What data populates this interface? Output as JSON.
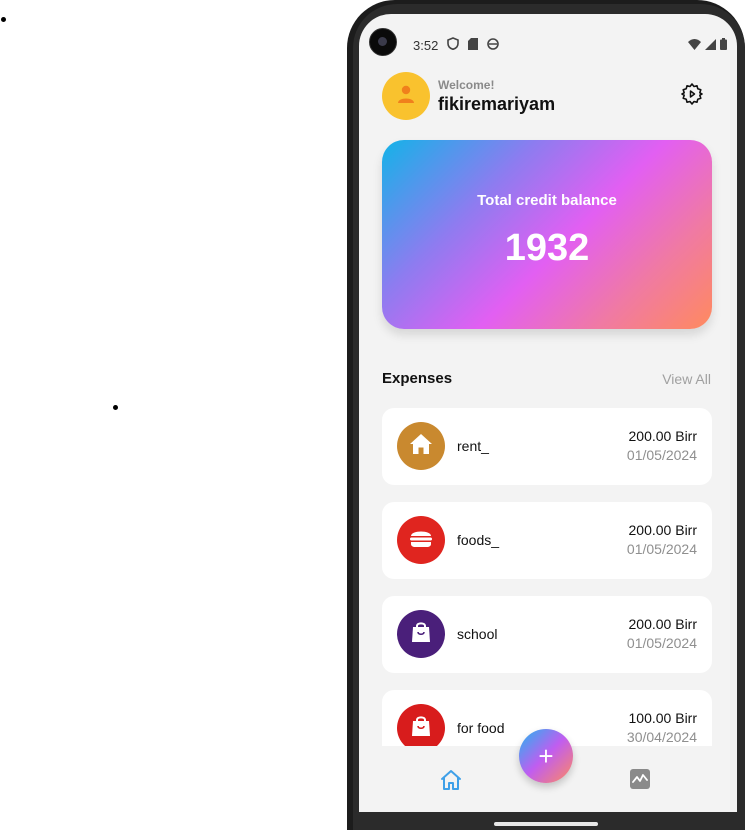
{
  "status_bar": {
    "time": "3:52"
  },
  "header": {
    "welcome": "Welcome!",
    "username": "fikiremariyam"
  },
  "balance_card": {
    "label": "Total credit balance",
    "value": "1932"
  },
  "expenses": {
    "title": "Expenses",
    "view_all": "View All",
    "items": [
      {
        "name": "rent_",
        "amount": "200.00 Birr",
        "date": "01/05/2024",
        "icon": "home-icon",
        "color": "#c9892f"
      },
      {
        "name": "foods_",
        "amount": "200.00 Birr",
        "date": "01/05/2024",
        "icon": "burger-icon",
        "color": "#e0251f"
      },
      {
        "name": "school",
        "amount": "200.00 Birr",
        "date": "01/05/2024",
        "icon": "shopping-bag-icon",
        "color": "#4a1f7a"
      },
      {
        "name": "for food",
        "amount": "100.00 Birr",
        "date": "30/04/2024",
        "icon": "shopping-bag-icon",
        "color": "#d81c1c"
      }
    ]
  },
  "bottom_nav": {
    "home_color": "#3fa0e8",
    "stats_color": "#8a8a8a",
    "fab_label": "+"
  }
}
